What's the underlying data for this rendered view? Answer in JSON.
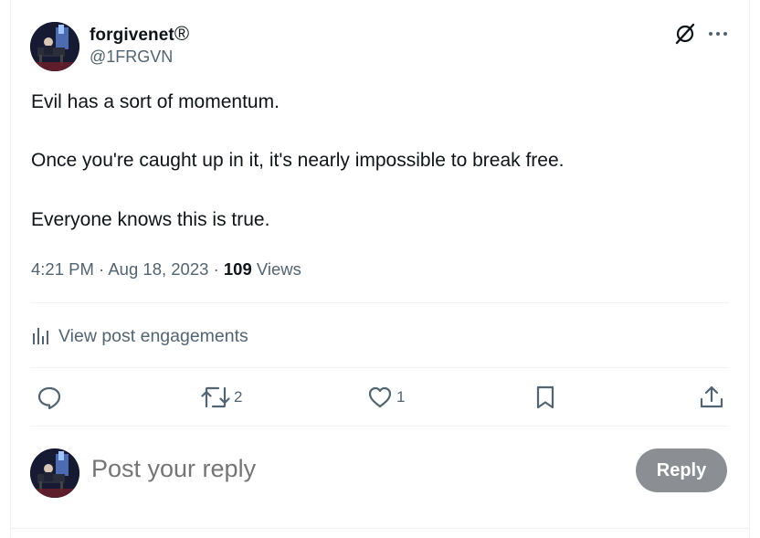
{
  "author": {
    "display_name": "forgivenet",
    "registered_mark": "®",
    "handle": "@1FRGVN"
  },
  "post": {
    "lines": [
      "Evil has a sort of momentum.",
      "Once you're caught up in it, it's nearly impossible to break free.",
      "Everyone knows this is true."
    ],
    "time": "4:21 PM",
    "date": "Aug 18, 2023",
    "separator": "·",
    "views_count": "109",
    "views_label": "Views"
  },
  "engagements": {
    "label": "View post engagements"
  },
  "actions": {
    "reply_icon": "speech-bubble-icon",
    "repost_count": "2",
    "like_count": "1",
    "bookmark_icon": "bookmark-icon",
    "share_icon": "share-icon"
  },
  "composer": {
    "placeholder": "Post your reply",
    "reply_label": "Reply"
  },
  "colors": {
    "text_primary": "#0f1419",
    "text_secondary": "#536471",
    "divider": "#eff3f4",
    "reply_button": "#8b8f93"
  }
}
